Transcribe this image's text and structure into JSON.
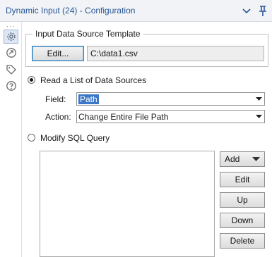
{
  "window": {
    "title": "Dynamic Input (24) - Configuration"
  },
  "rail": {
    "icons": [
      "gear-icon",
      "connection-icon",
      "tag-icon",
      "help-icon"
    ]
  },
  "template_group": {
    "legend": "Input Data Source Template",
    "edit_button": "Edit...",
    "path_value": "C:\\data1.csv"
  },
  "read_list": {
    "label": "Read a List of Data Sources",
    "selected": true,
    "field_label": "Field:",
    "field_value": "Path",
    "action_label": "Action:",
    "action_value": "Change Entire File Path"
  },
  "modify_sql": {
    "label": "Modify SQL Query",
    "selected": false
  },
  "buttons": {
    "add": "Add",
    "edit": "Edit",
    "up": "Up",
    "down": "Down",
    "delete": "Delete"
  },
  "colors": {
    "title_text": "#2b5797",
    "selection": "#3b76c9",
    "rail_active": "#dde6f2"
  }
}
